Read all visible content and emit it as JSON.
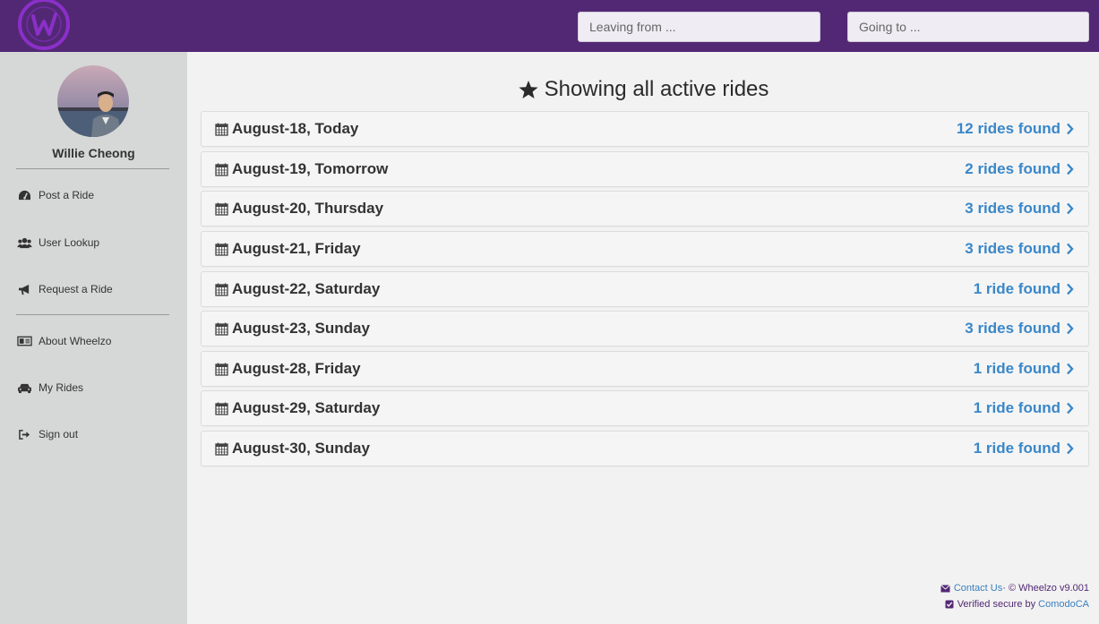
{
  "header": {
    "leaving_placeholder": "Leaving from ...",
    "going_placeholder": "Going to ...",
    "colors": {
      "bar": "#522874",
      "logo": "#8b2fc9"
    }
  },
  "sidebar": {
    "user_name": "Willie Cheong",
    "items": [
      {
        "label": "Post a Ride",
        "icon": "dashboard-icon"
      },
      {
        "label": "User Lookup",
        "icon": "users-icon"
      },
      {
        "label": "Request a Ride",
        "icon": "bullhorn-icon"
      },
      {
        "label": "About Wheelzo",
        "icon": "newspaper-icon"
      },
      {
        "label": "My Rides",
        "icon": "car-icon"
      },
      {
        "label": "Sign out",
        "icon": "sign-out-icon"
      }
    ]
  },
  "main": {
    "title": "Showing all active rides",
    "rides": [
      {
        "date": "August-18, Today",
        "count": "12 rides found"
      },
      {
        "date": "August-19, Tomorrow",
        "count": "2 rides found"
      },
      {
        "date": "August-20, Thursday",
        "count": "3 rides found"
      },
      {
        "date": "August-21, Friday",
        "count": "3 rides found"
      },
      {
        "date": "August-22, Saturday",
        "count": "1 ride found"
      },
      {
        "date": "August-23, Sunday",
        "count": "3 rides found"
      },
      {
        "date": "August-28, Friday",
        "count": "1 ride found"
      },
      {
        "date": "August-29, Saturday",
        "count": "1 ride found"
      },
      {
        "date": "August-30, Sunday",
        "count": "1 ride found"
      }
    ]
  },
  "footer": {
    "contact": "Contact Us",
    "copyright": " · © Wheelzo v9.001",
    "verified": "Verified secure by ",
    "ca": "ComodoCA"
  },
  "colors": {
    "link": "#3a87c8",
    "sidebar": "#d6d8d7",
    "background": "#f2f2f2"
  }
}
